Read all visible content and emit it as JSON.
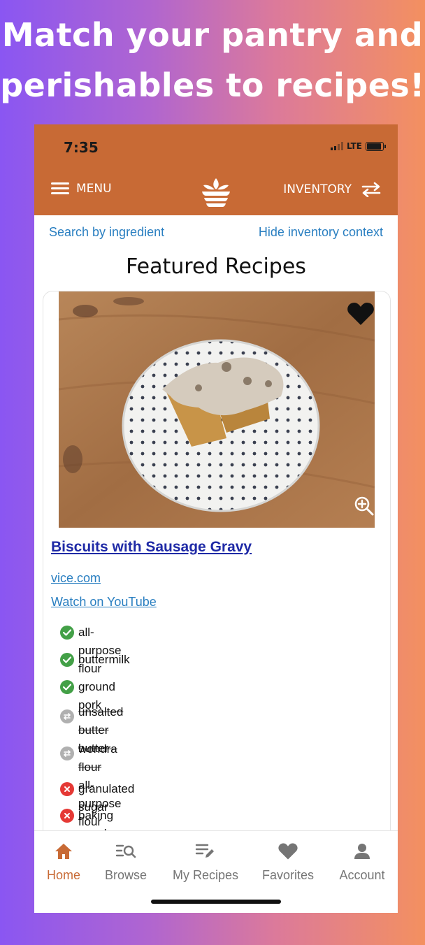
{
  "headline": {
    "line1": "Match your pantry and",
    "line2": "perishables to recipes!"
  },
  "status_bar": {
    "time": "7:35",
    "network": "LTE"
  },
  "top_nav": {
    "menu_label": "MENU",
    "inventory_label": "INVENTORY"
  },
  "links": {
    "search_by_ingredient": "Search by ingredient",
    "hide_inventory_context": "Hide inventory context"
  },
  "section_title": "Featured Recipes",
  "recipe": {
    "title": "Biscuits with Sausage Gravy",
    "source": "vice.com",
    "youtube": "Watch on YouTube",
    "favorited": true,
    "ingredients": [
      {
        "status": "have",
        "name": "all-purpose flour"
      },
      {
        "status": "have",
        "name": "buttermilk"
      },
      {
        "status": "have",
        "name": "ground pork"
      },
      {
        "status": "substitute",
        "original": "unsalted butter",
        "name": "butter"
      },
      {
        "status": "substitute",
        "original": "wondra flour",
        "name": "all-purpose flour"
      },
      {
        "status": "missing",
        "name": "granulated sugar"
      },
      {
        "status": "missing",
        "name": "baking powder"
      }
    ]
  },
  "tabs": [
    {
      "label": "Home",
      "icon": "home-icon",
      "active": true
    },
    {
      "label": "Browse",
      "icon": "browse-icon",
      "active": false
    },
    {
      "label": "My Recipes",
      "icon": "my-recipes-icon",
      "active": false
    },
    {
      "label": "Favorites",
      "icon": "heart-icon",
      "active": false
    },
    {
      "label": "Account",
      "icon": "account-icon",
      "active": false
    }
  ],
  "colors": {
    "header": "#c86a35",
    "link": "#2a7fc1",
    "recipe_title": "#1f2aa6",
    "have": "#43a047",
    "substitute": "#b0b0b0",
    "missing": "#e53935",
    "tab_active": "#c86a35",
    "tab_inactive": "#757575"
  }
}
